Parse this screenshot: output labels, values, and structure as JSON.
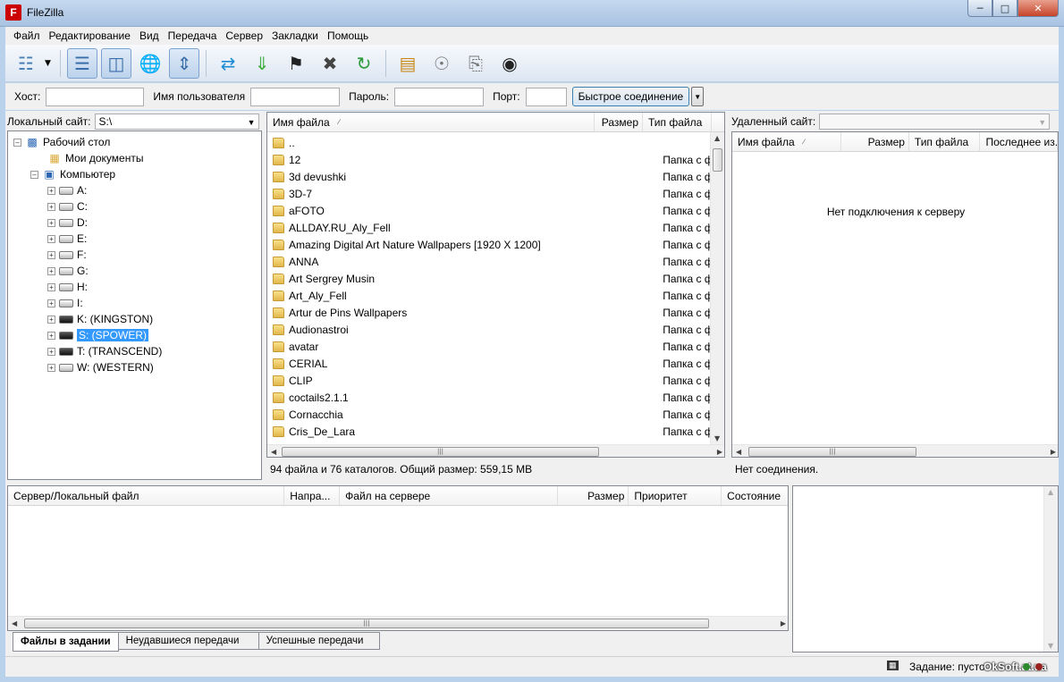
{
  "window": {
    "title": "FileZilla",
    "app_icon_letter": "F"
  },
  "menu": [
    "Файл",
    "Редактирование",
    "Вид",
    "Передача",
    "Сервер",
    "Закладки",
    "Помощь"
  ],
  "toolbar": {
    "icons": [
      "site-manager-icon",
      "message-log-icon",
      "local-tree-icon",
      "remote-tree-icon",
      "transfer-queue-icon",
      "refresh-icon",
      "process-queue-icon",
      "cancel-icon",
      "disconnect-icon",
      "reconnect-icon",
      "directory-listing-filters-icon",
      "compare-directories-icon",
      "sync-browsing-icon",
      "search-remote-icon"
    ]
  },
  "quickconnect": {
    "host_label": "Хост:",
    "user_label": "Имя пользователя",
    "pass_label": "Пароль:",
    "port_label": "Порт:",
    "host_value": "",
    "user_value": "",
    "pass_value": "",
    "port_value": "",
    "button_label": "Быстрое соединение"
  },
  "local": {
    "site_label": "Локальный сайт:",
    "site_value": "S:\\",
    "tree": {
      "desktop": "Рабочий стол",
      "my_documents": "Мои документы",
      "computer": "Компьютер",
      "drives": [
        "A:",
        "C:",
        "D:",
        "E:",
        "F:",
        "G:",
        "H:",
        "I:",
        "K: (KINGSTON)",
        "S: (SPOWER)",
        "T: (TRANSCEND)",
        "W: (WESTERN)"
      ],
      "selected_drive": "S: (SPOWER)"
    },
    "columns": {
      "name": "Имя файла",
      "size": "Размер",
      "type": "Тип файла"
    },
    "files": [
      {
        "name": "..",
        "type": ""
      },
      {
        "name": "12",
        "type": "Папка с фай"
      },
      {
        "name": "3d devushki",
        "type": "Папка с фай"
      },
      {
        "name": "3D-7",
        "type": "Папка с фай"
      },
      {
        "name": "aFOTO",
        "type": "Папка с фай"
      },
      {
        "name": "ALLDAY.RU_Aly_Fell",
        "type": "Папка с фай"
      },
      {
        "name": "Amazing Digital Art Nature Wallpapers [1920 X 1200]",
        "type": "Папка с фай"
      },
      {
        "name": "ANNA",
        "type": "Папка с фай"
      },
      {
        "name": "Art Sergrey Musin",
        "type": "Папка с фай"
      },
      {
        "name": "Art_Aly_Fell",
        "type": "Папка с фай"
      },
      {
        "name": "Artur de Pins Wallpapers",
        "type": "Папка с фай"
      },
      {
        "name": "Audionastroi",
        "type": "Папка с фай"
      },
      {
        "name": "avatar",
        "type": "Папка с фай"
      },
      {
        "name": "CERIAL",
        "type": "Папка с фай"
      },
      {
        "name": "CLIP",
        "type": "Папка с фай"
      },
      {
        "name": "coctails2.1.1",
        "type": "Папка с фай"
      },
      {
        "name": "Cornacchia",
        "type": "Папка с фай"
      },
      {
        "name": "Cris_De_Lara",
        "type": "Папка с фай"
      }
    ],
    "status": "94 файла и 76 каталогов. Общий размер: 559,15 MB"
  },
  "remote": {
    "site_label": "Удаленный сайт:",
    "site_value": "",
    "columns": {
      "name": "Имя файла",
      "size": "Размер",
      "type": "Тип файла",
      "modified": "Последнее из..."
    },
    "empty_message": "Нет подключения к серверу",
    "status": "Нет соединения."
  },
  "queue": {
    "columns": {
      "server_file": "Сервер/Локальный файл",
      "direction": "Напра...",
      "remote_file": "Файл на сервере",
      "size": "Размер",
      "priority": "Приоритет",
      "state": "Состояние"
    },
    "tabs": [
      "Файлы в задании",
      "Неудавшиеся передачи",
      "Успешные передачи"
    ]
  },
  "statusbar": {
    "queue_text": "Задание: пусто",
    "watermark": "OkSoft.at.ua"
  },
  "colors": {
    "selection": "#3399ff",
    "folder": "#e1b74c"
  }
}
